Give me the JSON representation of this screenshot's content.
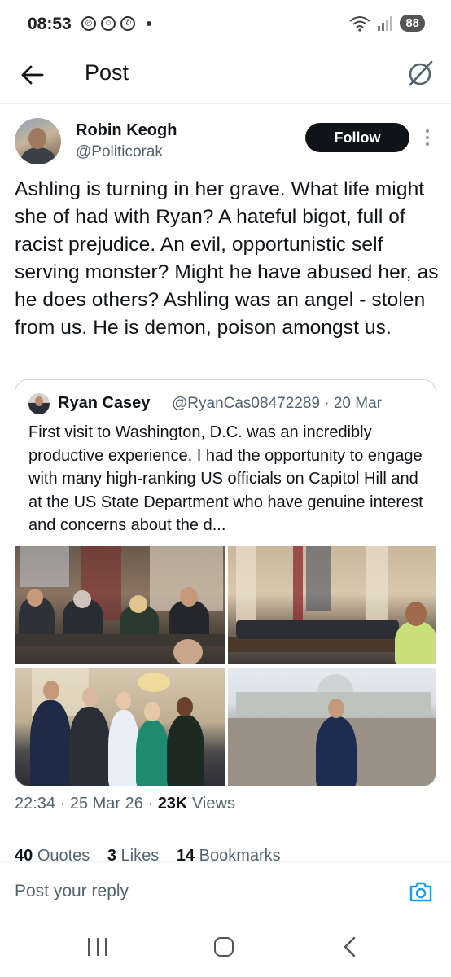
{
  "status_bar": {
    "time": "08:53",
    "battery": "88",
    "notification_icons": [
      "data-saver-icon",
      "snapchat-icon",
      "whatsapp-icon",
      "more-dot-icon"
    ]
  },
  "header": {
    "title": "Post"
  },
  "post": {
    "author_name": "Robin Keogh",
    "author_handle": "@Politicorak",
    "follow_label": "Follow",
    "text": "Ashling is turning in her grave. What life might she of had with Ryan? A hateful bigot, full of racist prejudice. An evil, opportunistic self serving monster? Might he have abused her, as he does others? Ashling was an angel -  stolen from us. He is demon, poison amongst us.",
    "quote": {
      "author_name": "Ryan Casey",
      "meta": "@RyanCas08472289 · 20 Mar",
      "text": "First visit to Washington, D.C. was an incredibly productive experience. I had the opportunity to engage with many high-ranking US officials on Capitol Hill and at the US State Department who have genuine interest and concerns about the d..."
    },
    "time": "22:34",
    "date": "25 Mar 26",
    "views_count": "23K",
    "views_label": "Views",
    "stats": [
      {
        "count": "40",
        "label": "Quotes"
      },
      {
        "count": "3",
        "label": "Likes"
      },
      {
        "count": "14",
        "label": "Bookmarks"
      }
    ]
  },
  "reply": {
    "placeholder": "Post your reply"
  },
  "colors": {
    "text_primary": "#0f1419",
    "text_secondary": "#536471",
    "accent": "#1d9bf0",
    "follow_bg": "#0f1419"
  }
}
